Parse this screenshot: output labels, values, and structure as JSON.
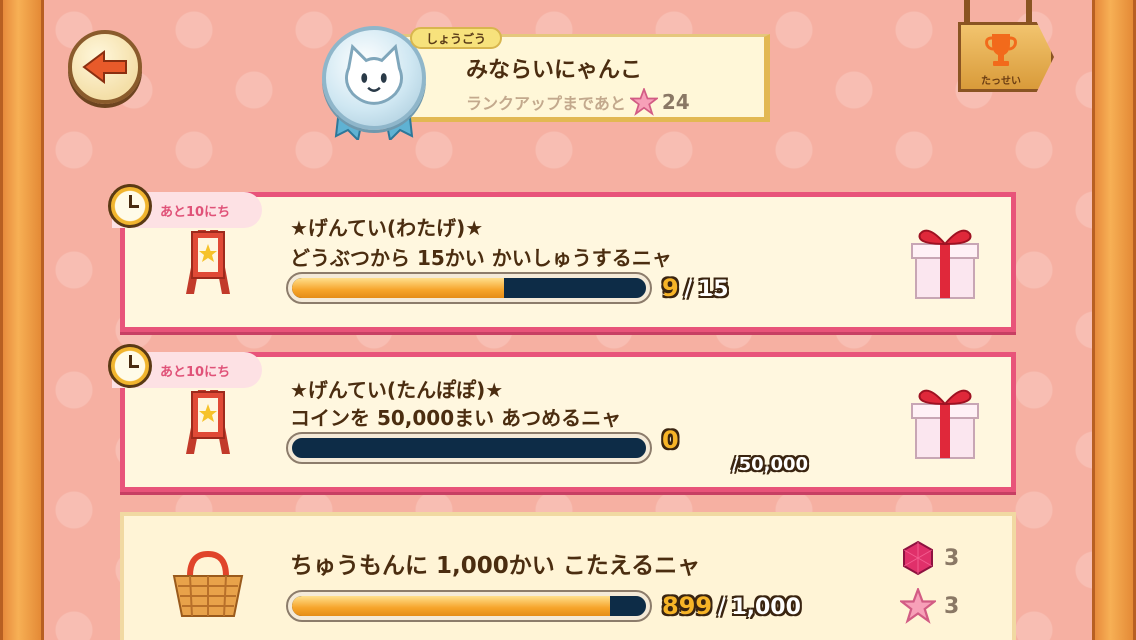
{
  "header": {
    "back_icon": "back-arrow-icon",
    "rank_tag": "しょうごう",
    "rank_title": "みならいにゃんこ",
    "rank_up_text": "ランクアップまであと",
    "rank_up_remaining": "24",
    "trophy_label": "たっせい"
  },
  "missions": [
    {
      "days_left": "あと10にち",
      "title": "★げんてい(わたげ)★",
      "description": "どうぶつから 15かい かいしゅうするニャ",
      "current": "9",
      "separator": "/",
      "total": "15",
      "progress": 0.6,
      "reward_icon": "gift-box-icon"
    },
    {
      "days_left": "あと10にち",
      "title": "★げんてい(たんぽぽ)★",
      "description": "コインを 50,000まい あつめるニャ",
      "current": "0",
      "separator": "/",
      "total": "50,000",
      "progress": 0.0,
      "reward_icon": "gift-box-icon"
    },
    {
      "description": "ちゅうもんに 1,000かい こたえるニャ",
      "current": "899",
      "separator": "/",
      "total": "1,000",
      "progress": 0.899,
      "rewards": [
        {
          "icon": "gem-icon",
          "amount": "3"
        },
        {
          "icon": "pink-star-icon",
          "amount": "3"
        }
      ]
    }
  ],
  "colors": {
    "background": "#f6b0a2",
    "mission_border": "#e8547a",
    "progress_fill": "#f6a42a",
    "progress_track": "#0d2c47"
  }
}
